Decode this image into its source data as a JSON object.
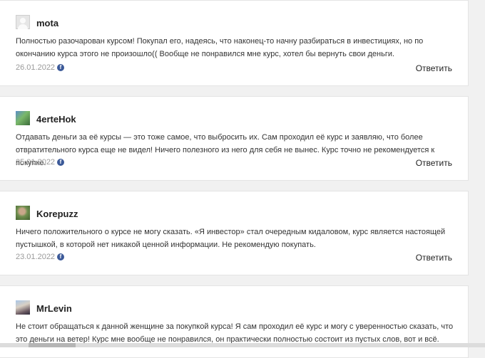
{
  "comments": [
    {
      "author": "mota",
      "avatar_icon": "default-user-avatar",
      "text": "Полностью разочарован курсом! Покупал его, надеясь, что наконец-то начну разбираться в инвестициях, но по окончанию курса этого не произошло(( Вообще не понравился мне курс, хотел бы вернуть свои деньги.",
      "date": "26.01.2022",
      "reply_label": "Ответить"
    },
    {
      "author": "4erteHok",
      "avatar_icon": "user-photo-avatar",
      "text": "Отдавать деньги за её курсы — это тоже самое, что выбросить их. Сам проходил её курс и заявляю, что более отвратительного курса еще не видел! Ничего полезного из него для себя не вынес. Курс точно не рекомендуется к покупке.",
      "date": "25.01.2022",
      "reply_label": "Ответить"
    },
    {
      "author": "Korepuzz",
      "avatar_icon": "user-photo-avatar",
      "text": "Ничего положительного о курсе не могу сказать. «Я инвестор» стал очередным кидаловом, курс является настоящей пустышкой, в которой нет никакой ценной информации. Не рекомендую покупать.",
      "date": "23.01.2022",
      "reply_label": "Ответить"
    },
    {
      "author": "MrLevin",
      "avatar_icon": "user-photo-avatar",
      "text": "Не стоит обращаться к данной женщине за покупкой курса! Я сам проходил её курс и могу с уверенностью сказать, что это деньги на ветер! Курс мне вообще не понравился, он практически полностью состоит из пустых слов, вот и всё."
    }
  ],
  "social_icon": "facebook-icon",
  "social_glyph": "f",
  "colors": {
    "background": "#f1f1f1",
    "card": "#ffffff",
    "date": "#9a9a9a",
    "facebook": "#3b5998"
  }
}
